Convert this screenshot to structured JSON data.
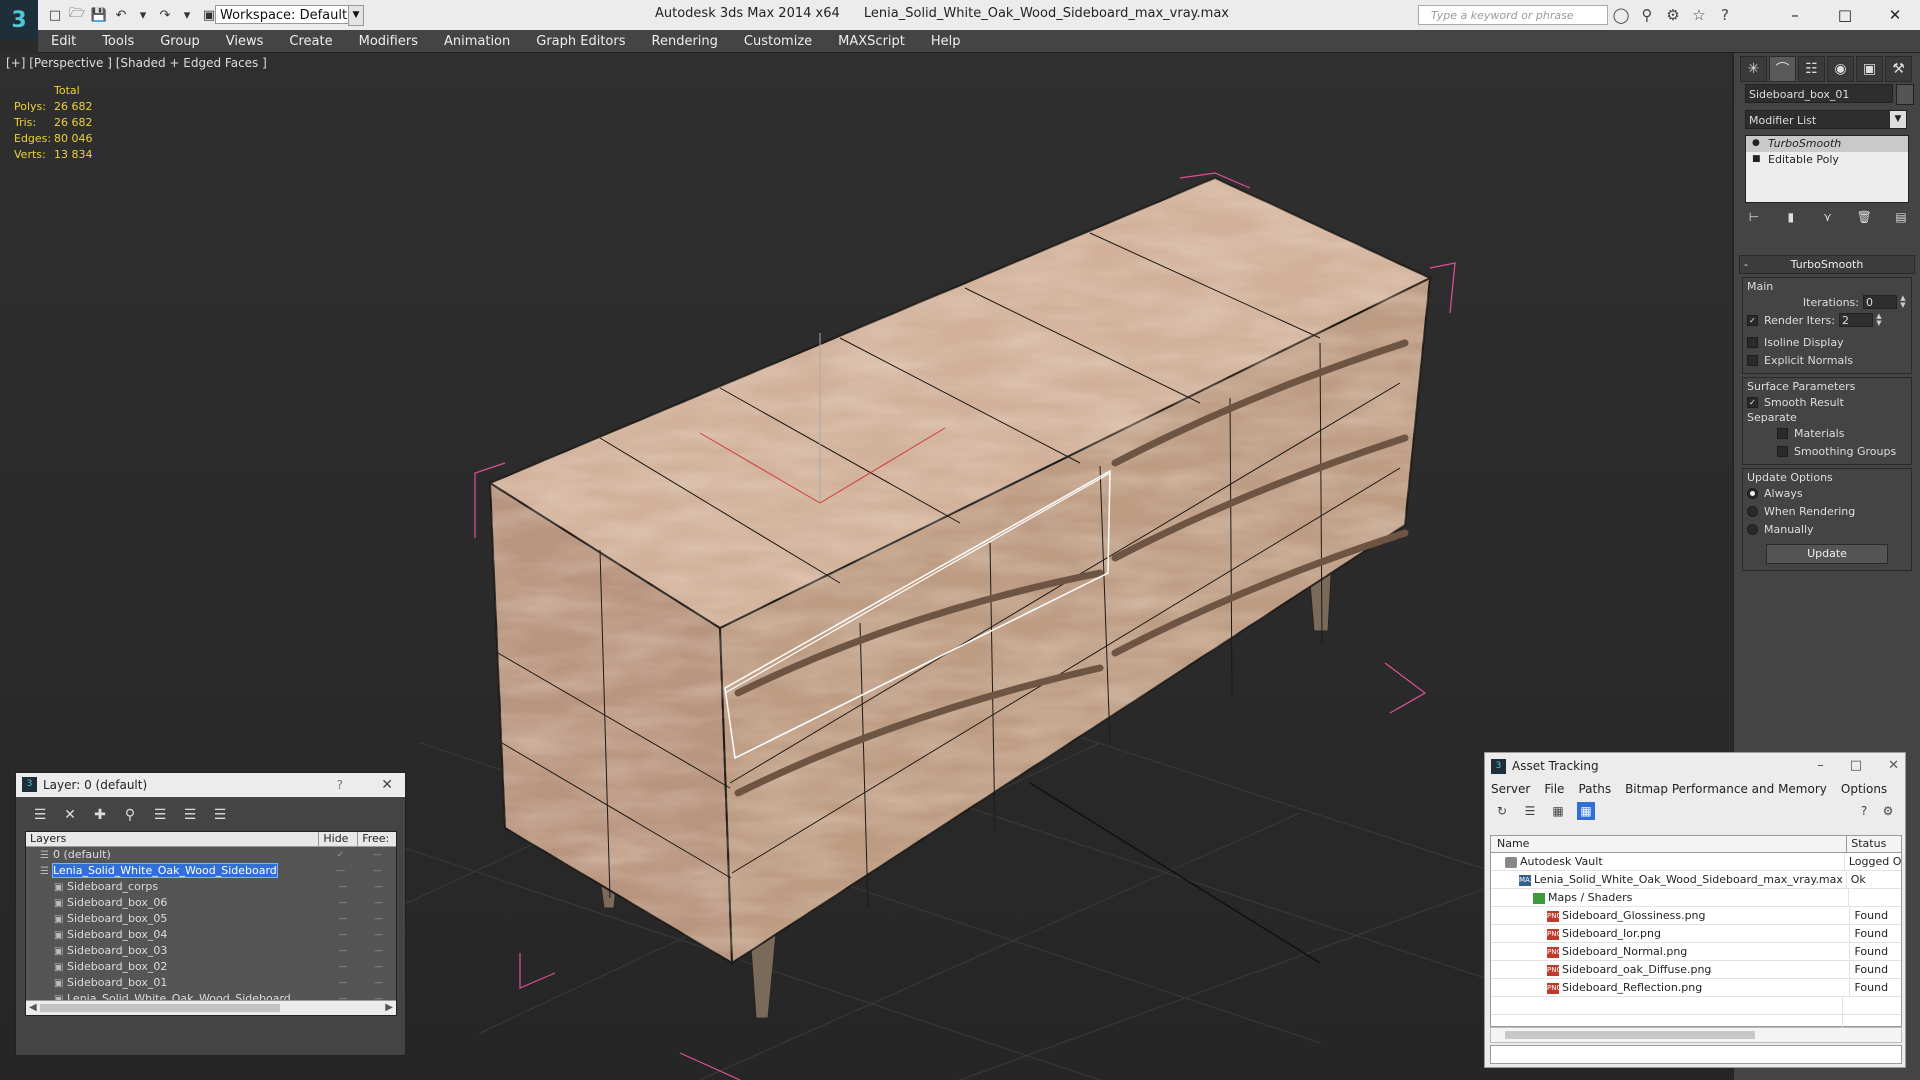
{
  "app": {
    "title": "Autodesk 3ds Max  2014 x64",
    "file": "Lenia_Solid_White_Oak_Wood_Sideboard_max_vray.max",
    "workspace": "Workspace: Default",
    "search_placeholder": "Type a keyword or phrase"
  },
  "menu": [
    "Edit",
    "Tools",
    "Group",
    "Views",
    "Create",
    "Modifiers",
    "Animation",
    "Graph Editors",
    "Rendering",
    "Customize",
    "MAXScript",
    "Help"
  ],
  "viewport": {
    "label": "[+] [Perspective ] [Shaded + Edged Faces ]",
    "stats": {
      "header": "Total",
      "rows": [
        {
          "label": "Polys:",
          "value": "26 682"
        },
        {
          "label": "Tris:",
          "value": "26 682"
        },
        {
          "label": "Edges:",
          "value": "80 046"
        },
        {
          "label": "Verts:",
          "value": "13 834"
        }
      ]
    }
  },
  "command_panel": {
    "object_name": "Sideboard_box_01",
    "modifier_list": "Modifier List",
    "stack": [
      "TurboSmooth",
      "Editable Poly"
    ],
    "rollout_title": "TurboSmooth",
    "main_label": "Main",
    "iterations_label": "Iterations:",
    "iterations_value": "0",
    "render_iters_label": "Render Iters:",
    "render_iters_value": "2",
    "isoline_label": "Isoline Display",
    "explicit_normals_label": "Explicit Normals",
    "surface_label": "Surface Parameters",
    "smooth_result_label": "Smooth Result",
    "separate_label": "Separate",
    "materials_label": "Materials",
    "smoothing_groups_label": "Smoothing Groups",
    "update_options_label": "Update Options",
    "always_label": "Always",
    "when_rendering_label": "When Rendering",
    "manually_label": "Manually",
    "update_button": "Update"
  },
  "layer_window": {
    "title": "Layer: 0 (default)",
    "help": "?",
    "columns": [
      "Layers",
      "Hide",
      "Free:"
    ],
    "rows": [
      {
        "name": "0 (default)",
        "indent": 1
      },
      {
        "name": "Lenia_Solid_White_Oak_Wood_Sideboard",
        "indent": 1
      },
      {
        "name": "Sideboard_corps",
        "indent": 2
      },
      {
        "name": "Sideboard_box_06",
        "indent": 2
      },
      {
        "name": "Sideboard_box_05",
        "indent": 2
      },
      {
        "name": "Sideboard_box_04",
        "indent": 2
      },
      {
        "name": "Sideboard_box_03",
        "indent": 2
      },
      {
        "name": "Sideboard_box_02",
        "indent": 2
      },
      {
        "name": "Sideboard_box_01",
        "indent": 2
      },
      {
        "name": "Lenia_Solid_White_Oak_Wood_Sideboard",
        "indent": 2
      }
    ]
  },
  "asset_tracking": {
    "title": "Asset Tracking",
    "menu": [
      "Server",
      "File",
      "Paths",
      "Bitmap Performance and Memory",
      "Options"
    ],
    "columns": [
      "Name",
      "Status"
    ],
    "rows": [
      {
        "name": "Autodesk Vault",
        "status": "Logged O",
        "icon": "vault",
        "indent": 1
      },
      {
        "name": "Lenia_Solid_White_Oak_Wood_Sideboard_max_vray.max",
        "status": "Ok",
        "icon": "max",
        "indent": 2
      },
      {
        "name": "Maps / Shaders",
        "status": "",
        "icon": "maps",
        "indent": 3
      },
      {
        "name": "Sideboard_Glossiness.png",
        "status": "Found",
        "icon": "png",
        "indent": 4
      },
      {
        "name": "Sideboard_Ior.png",
        "status": "Found",
        "icon": "png",
        "indent": 4
      },
      {
        "name": "Sideboard_Normal.png",
        "status": "Found",
        "icon": "png",
        "indent": 4
      },
      {
        "name": "Sideboard_oak_Diffuse.png",
        "status": "Found",
        "icon": "png",
        "indent": 4
      },
      {
        "name": "Sideboard_Reflection.png",
        "status": "Found",
        "icon": "png",
        "indent": 4
      }
    ]
  }
}
